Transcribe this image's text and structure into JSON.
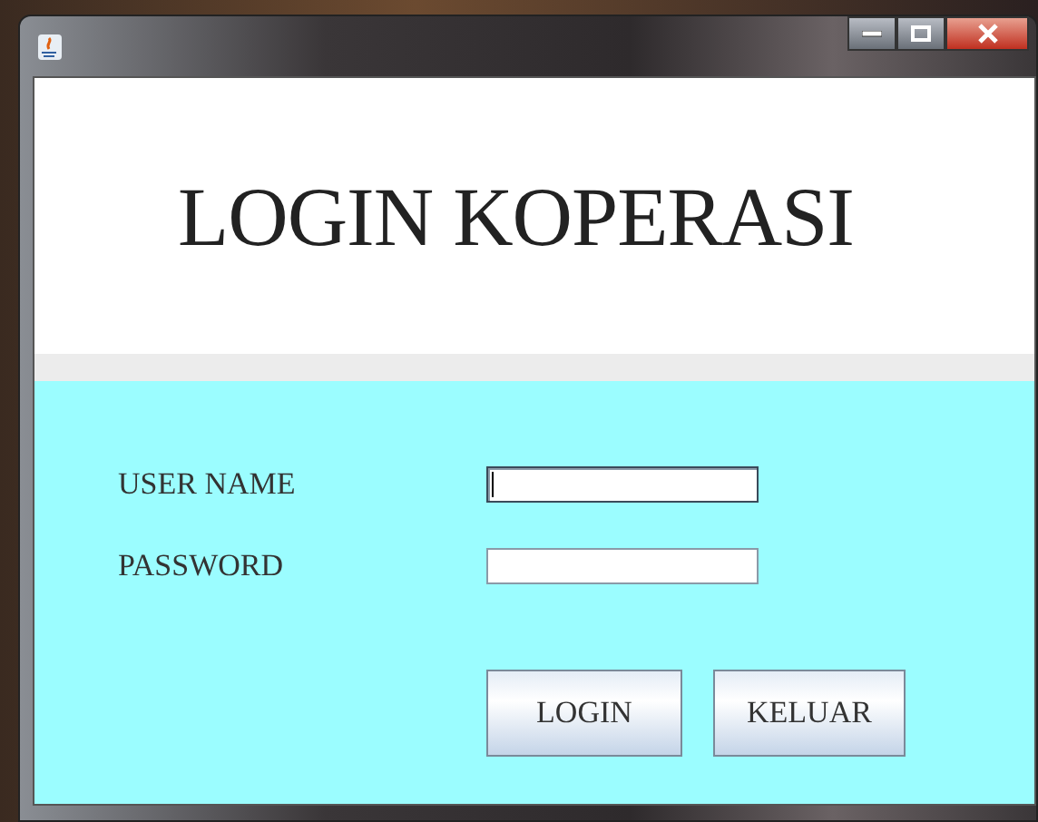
{
  "window": {
    "controls": [
      {
        "kind": "minimize"
      },
      {
        "kind": "maximize"
      },
      {
        "kind": "close"
      }
    ]
  },
  "heading": "LOGIN KOPERASI",
  "fields": [
    {
      "label": "USER NAME",
      "focused": true
    },
    {
      "label": "PASSWORD",
      "focused": false
    }
  ],
  "buttons": [
    "LOGIN",
    "KELUAR"
  ]
}
